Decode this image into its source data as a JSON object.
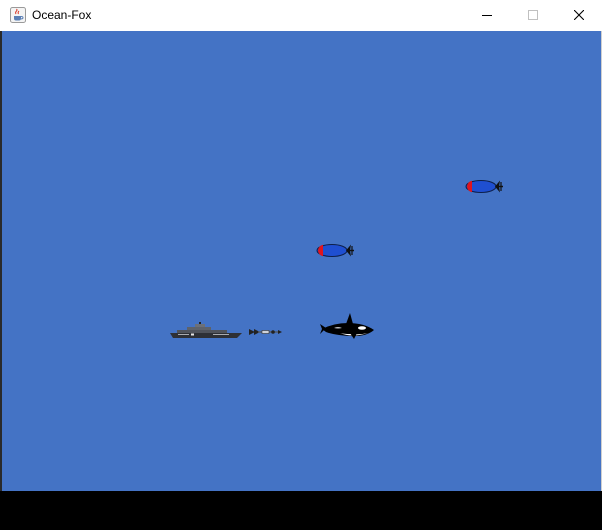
{
  "window": {
    "title": "Ocean-Fox",
    "icon": "java-cup-icon",
    "controls": {
      "minimize_icon": "minimize-icon",
      "maximize_icon": "maximize-icon",
      "close_icon": "close-icon"
    }
  },
  "colors": {
    "ocean": "#4473c5",
    "bottom_bar": "#000000",
    "torpedo_body": "#1f4fd1",
    "torpedo_nose": "#e0141e",
    "ship_hull": "#2e3036",
    "orca": "#000000"
  },
  "game": {
    "sprites": [
      {
        "type": "player-ship",
        "icon": "warship-icon"
      },
      {
        "type": "projectile",
        "icon": "harpoon-icon"
      },
      {
        "type": "enemy",
        "icon": "orca-icon"
      },
      {
        "type": "enemy",
        "icon": "torpedo-icon"
      },
      {
        "type": "enemy",
        "icon": "torpedo-icon"
      }
    ]
  }
}
